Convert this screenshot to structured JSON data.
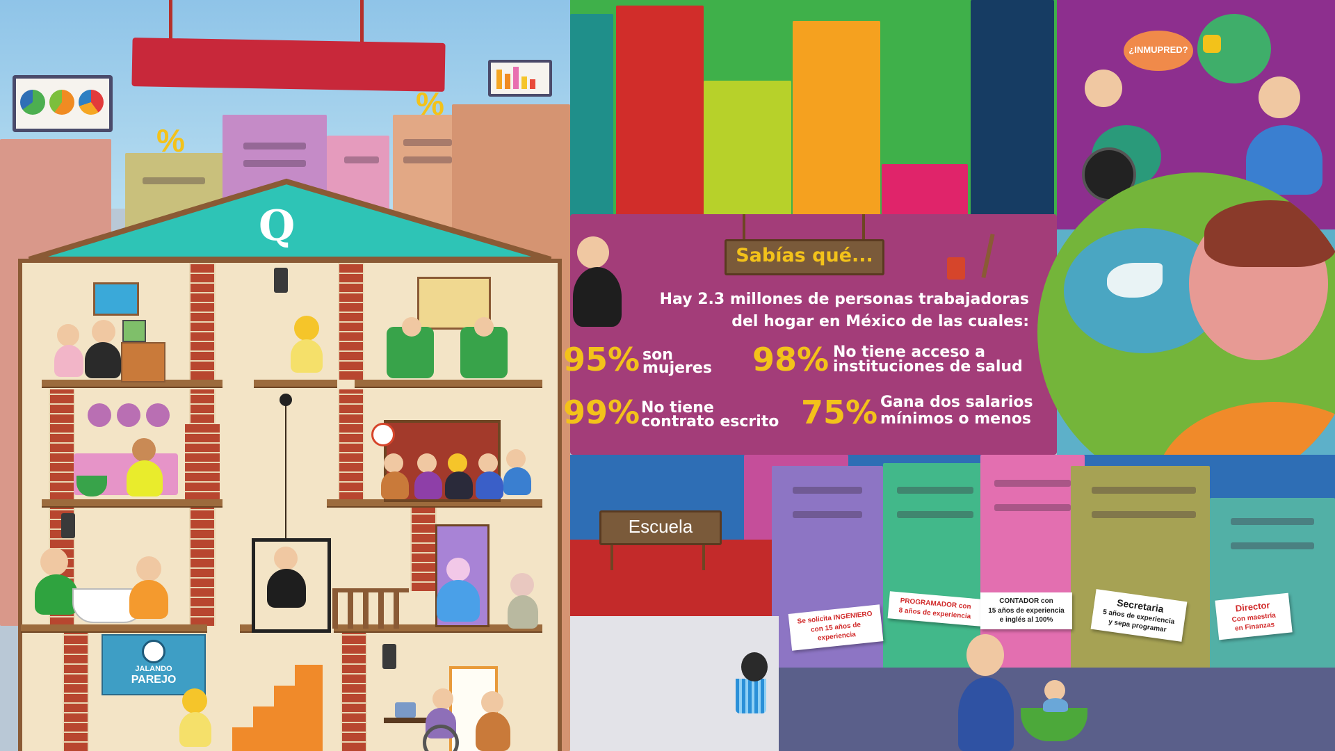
{
  "house": {
    "emblem": "Q",
    "banner_line1": "JALANDO",
    "banner_line2": "PAREJO"
  },
  "billboard": {
    "percent_symbol": "%"
  },
  "info_board": {
    "heading": "Sabías qué...",
    "intro_line1": "Hay 2.3 millones de personas trabajadoras",
    "intro_line2": "del hogar en México de las cuales:",
    "stats": [
      {
        "pct": "95%",
        "line1": "son",
        "line2": "mujeres"
      },
      {
        "pct": "98%",
        "line1": "No tiene acceso a",
        "line2": "instituciones de salud"
      },
      {
        "pct": "99%",
        "line1": "No tiene",
        "line2": "contrato escrito"
      },
      {
        "pct": "75%",
        "line1": "Gana dos salarios",
        "line2": "mínimos o menos"
      }
    ]
  },
  "speech_bubble": {
    "text": "¿INMUPRED?"
  },
  "school": {
    "sign": "Escuela"
  },
  "job_signs": [
    {
      "lines": [
        "Se solicita INGENIERO",
        "con 15 años de",
        "experiencia"
      ]
    },
    {
      "lines": [
        "PROGRAMADOR con",
        "8 años de experiencia"
      ]
    },
    {
      "lines": [
        "CONTADOR con",
        "15 años de experiencia",
        "e inglés al 100%"
      ]
    },
    {
      "title": "Secretaria",
      "lines": [
        "5 años de experiencia",
        "y sepa programar"
      ]
    },
    {
      "title": "Director",
      "lines": [
        "Con maestría",
        "en Finanzas"
      ]
    }
  ],
  "colors": {
    "info_bg": "#a33d79",
    "stat_yellow": "#f3c21a",
    "roof_teal": "#2ec4b6",
    "sign_red": "#d12b2b"
  }
}
